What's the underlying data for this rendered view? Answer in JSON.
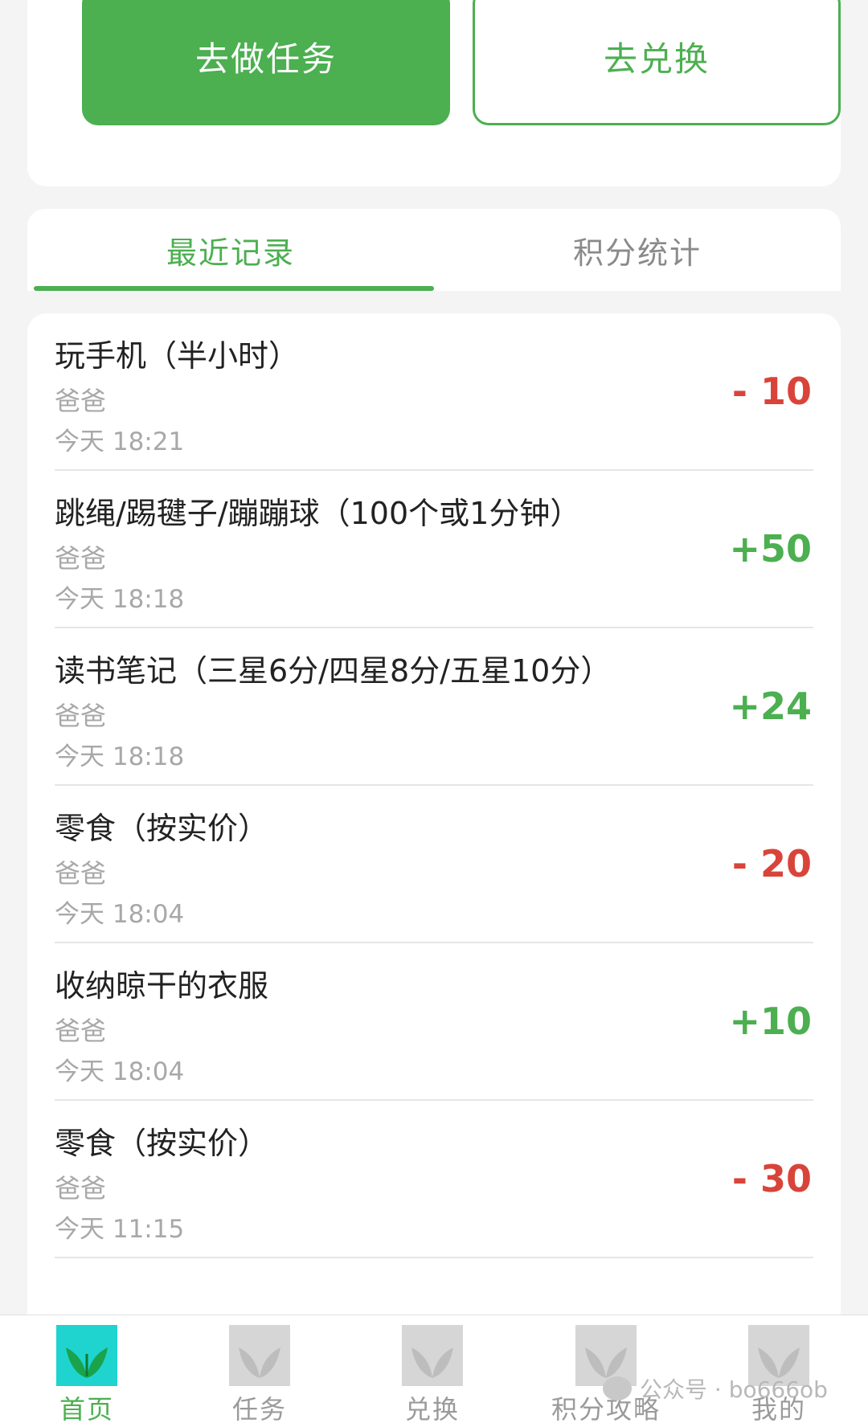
{
  "actions": {
    "do_task_label": "去做任务",
    "exchange_label": "去兑换"
  },
  "tabs": [
    {
      "label": "最近记录",
      "active": true
    },
    {
      "label": "积分统计",
      "active": false
    }
  ],
  "records": [
    {
      "title": "玩手机（半小时）",
      "who": "爸爸",
      "time": "今天 18:21",
      "points": "- 10",
      "type": "negative"
    },
    {
      "title": "跳绳/踢毽子/蹦蹦球（100个或1分钟）",
      "who": "爸爸",
      "time": "今天 18:18",
      "points": "+50",
      "type": "positive"
    },
    {
      "title": "读书笔记（三星6分/四星8分/五星10分）",
      "who": "爸爸",
      "time": "今天 18:18",
      "points": "+24",
      "type": "positive"
    },
    {
      "title": "零食（按实价）",
      "who": "爸爸",
      "time": "今天 18:04",
      "points": "- 20",
      "type": "negative"
    },
    {
      "title": "收纳晾干的衣服",
      "who": "爸爸",
      "time": "今天 18:04",
      "points": "+10",
      "type": "positive"
    },
    {
      "title": "零食（按实价）",
      "who": "爸爸",
      "time": "今天 11:15",
      "points": "- 30",
      "type": "negative"
    }
  ],
  "nav": [
    {
      "label": "首页",
      "active": true,
      "icon": "home-leaf-icon"
    },
    {
      "label": "任务",
      "active": false,
      "icon": "task-leaf-icon"
    },
    {
      "label": "兑换",
      "active": false,
      "icon": "exchange-leaf-icon"
    },
    {
      "label": "积分攻略",
      "active": false,
      "icon": "guide-leaf-icon"
    },
    {
      "label": "我的",
      "active": false,
      "icon": "profile-leaf-icon"
    }
  ],
  "watermark": "公众号 · bo666ob",
  "colors": {
    "primary_green": "#4caf50",
    "negative_red": "#d9443a",
    "active_icon_bg": "#1fd3cf"
  }
}
